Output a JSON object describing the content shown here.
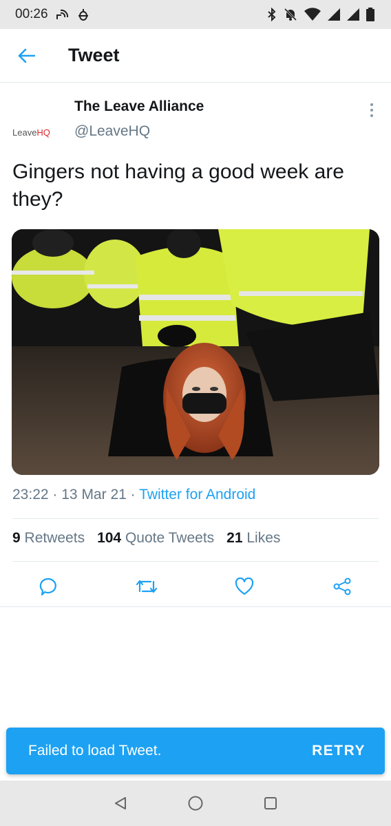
{
  "status_bar": {
    "time": "00:26",
    "left_icons": [
      "wifi-calling-icon",
      "android-debug-icon"
    ],
    "right_icons": [
      "bluetooth-icon",
      "mute-bell-icon",
      "wifi-icon",
      "signal-icon",
      "signal-icon",
      "battery-icon"
    ]
  },
  "header": {
    "title": "Tweet",
    "back_icon": "arrow-left-icon"
  },
  "tweet": {
    "author_name": "The Leave Alliance",
    "author_handle": "@LeaveHQ",
    "avatar_text_a": "Leave",
    "avatar_text_b": "HQ",
    "text": "Gingers not having a good week are they?",
    "time": "23:22",
    "separator": "·",
    "date": "13 Mar 21",
    "source": "Twitter for Android"
  },
  "stats": {
    "retweets_count": "9",
    "retweets_label": "Retweets",
    "quote_count": "104",
    "quote_label": "Quote Tweets",
    "likes_count": "21",
    "likes_label": "Likes"
  },
  "actions": [
    "reply-icon",
    "retweet-icon",
    "like-icon",
    "share-icon"
  ],
  "snackbar": {
    "message": "Failed to load Tweet.",
    "action": "RETRY"
  },
  "colors": {
    "accent": "#1da1f2",
    "secondary_text": "#657786",
    "primary_text": "#14171a",
    "system_bar": "#e8e8e8"
  }
}
